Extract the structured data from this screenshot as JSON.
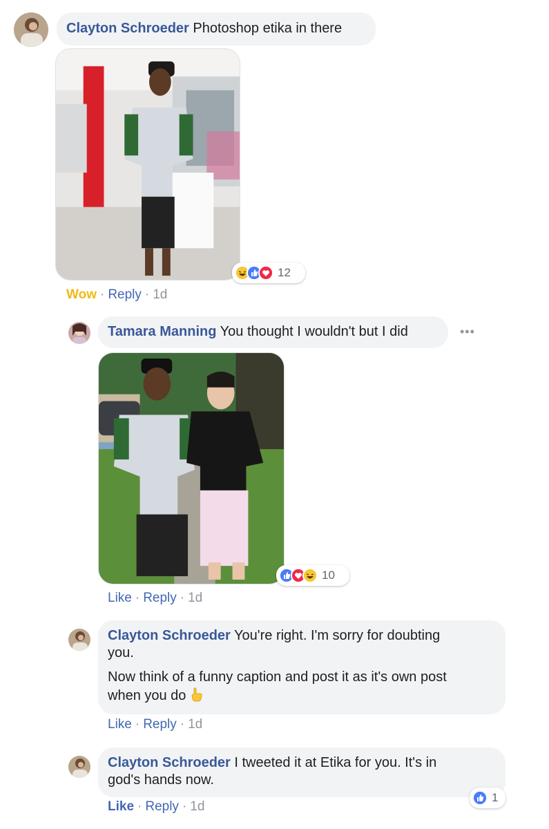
{
  "comments": [
    {
      "author": "Clayton Schroeder",
      "text": "Photoshop etika in there",
      "actions": {
        "first": "Wow",
        "reply": "Reply",
        "time": "1d"
      },
      "reactions": {
        "icons": [
          "haha-icon",
          "like-icon",
          "love-icon"
        ],
        "count": "12"
      }
    },
    {
      "author": "Tamara Manning",
      "text": "You thought I wouldn't but I did",
      "more": "•••",
      "actions": {
        "first": "Like",
        "reply": "Reply",
        "time": "1d"
      },
      "reactions": {
        "icons": [
          "like-icon",
          "love-icon",
          "haha-icon"
        ],
        "count": "10"
      }
    },
    {
      "author": "Clayton Schroeder",
      "text_line1_rest": "You're right. I'm sorry for doubting",
      "text_line2": "you.",
      "text_para2_line1": "Now think of a funny caption and post it as it's own post",
      "text_para2_line2": "when you do",
      "emoji": "pointing-hand-icon",
      "actions": {
        "first": "Like",
        "reply": "Reply",
        "time": "1d"
      }
    },
    {
      "author": "Clayton Schroeder",
      "text_line1_rest": "I tweeted it at Etika for you. It's in",
      "text_line2": "god's hands now.",
      "actions": {
        "first": "Like",
        "reply": "Reply",
        "time": "1d"
      },
      "reactions": {
        "icons": [
          "like-icon"
        ],
        "count": "1"
      }
    }
  ],
  "colors": {
    "author": "#385898",
    "link": "#4267b2",
    "wow": "#f0ba15",
    "bubble": "#f2f3f5",
    "meta": "#90949c"
  }
}
